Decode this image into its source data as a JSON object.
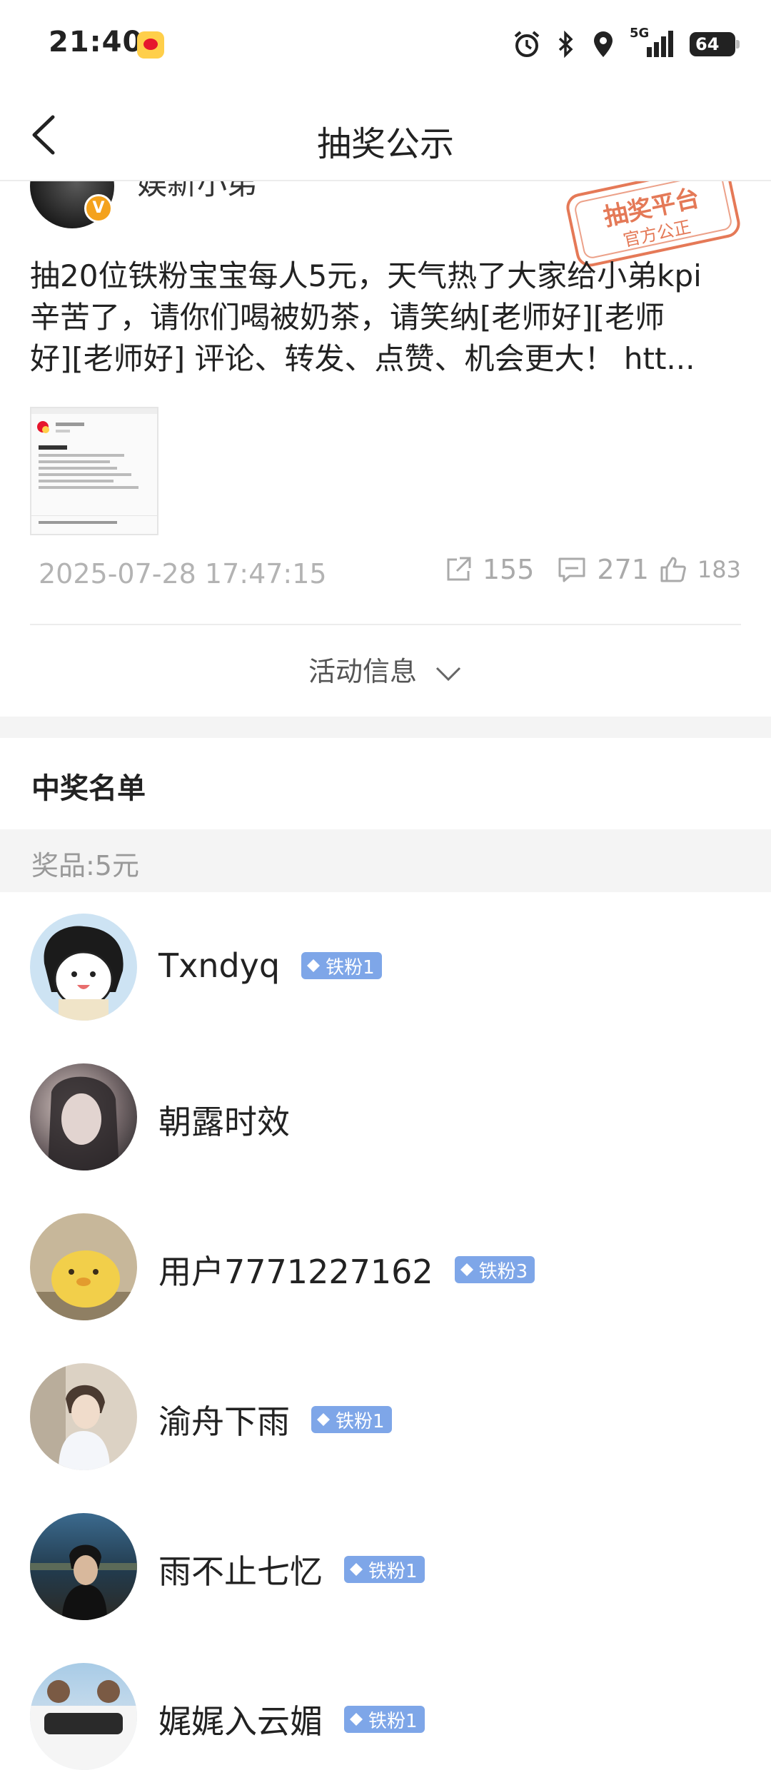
{
  "status_bar": {
    "time": "21:40",
    "network": "5G",
    "battery": "64",
    "icons": [
      "weibo-app-icon",
      "alarm-icon",
      "bluetooth-icon",
      "location-icon",
      "signal-icon",
      "battery-icon"
    ]
  },
  "nav": {
    "title": "抽奖公示",
    "back_icon": "back-arrow-icon"
  },
  "post": {
    "author_name": "娱新小弟",
    "stamp_line1": "抽奖平台",
    "stamp_line2": "官方公正",
    "text_lines": [
      "抽20位铁粉宝宝每人5元，天气热了大家给小弟kpi",
      "辛苦了，请你们喝被奶茶，请笑纳[老师好][老师",
      "好][老师好] 评论、转发、点赞、机会更大！  htt..."
    ],
    "timestamp": "2025-07-28 17:47:15",
    "reposts": "155",
    "comments": "271",
    "likes": "183",
    "activity_info": "活动信息"
  },
  "winners": {
    "title": "中奖名单",
    "prize": "奖品:5元",
    "list": [
      {
        "name": "Txndyq",
        "badge": "铁粉1"
      },
      {
        "name": "朝露时效",
        "badge": ""
      },
      {
        "name": "用户7771227162",
        "badge": "铁粉3"
      },
      {
        "name": "渝舟下雨",
        "badge": "铁粉1"
      },
      {
        "name": "雨不止七忆",
        "badge": "铁粉1"
      },
      {
        "name": "娓娓入云媚",
        "badge": "铁粉1"
      }
    ]
  },
  "colors": {
    "fan_badge": "#7ea6e8",
    "stamp": "#e0623a",
    "vip_badge": "#f4a21c"
  }
}
